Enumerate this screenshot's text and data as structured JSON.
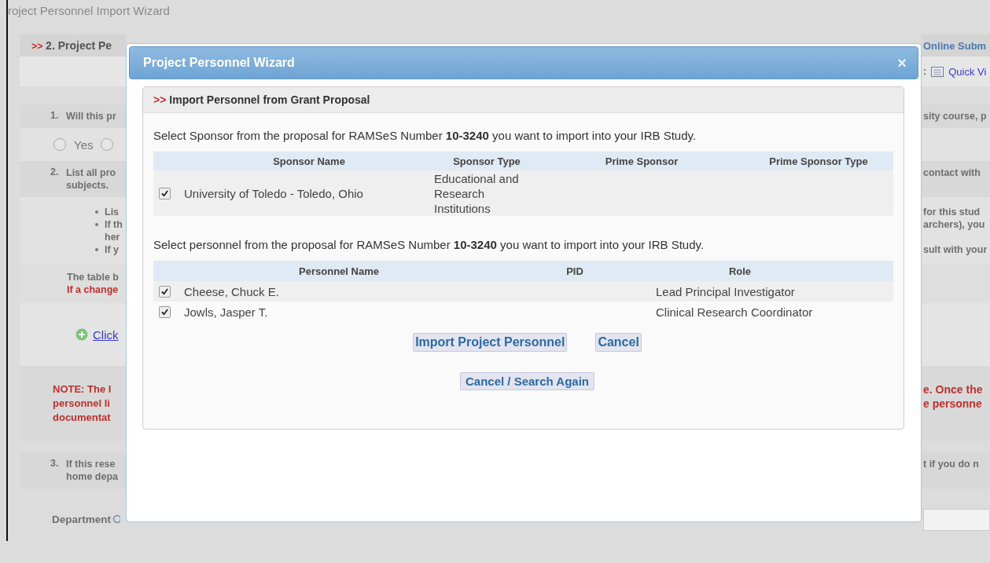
{
  "background": {
    "title": "roject Personnel Import Wizard",
    "rows": [
      {
        "kind": "header",
        "marker": ">>",
        "left": "2. Project Pe",
        "right": "Online Subm"
      },
      {
        "kind": "toolbar",
        "right_separator": ":",
        "right_link": "Quick Vi"
      },
      {
        "kind": "question",
        "number": "1.",
        "lines": [
          "Will this pr"
        ],
        "right_lines": [
          "sity course, p"
        ]
      },
      {
        "kind": "radios",
        "options": [
          {
            "label": "Yes",
            "selected": false
          },
          {
            "selected": false
          }
        ]
      },
      {
        "kind": "question",
        "number": "2.",
        "lines": [
          "List all pro",
          "subjects."
        ],
        "right_lines": [
          "contact with"
        ]
      },
      {
        "kind": "bullets",
        "lines": [
          {
            "text": "Lis",
            "bullet": true,
            "right": "for this stud"
          },
          {
            "text": "If th",
            "bullet": true,
            "right": "archers), you"
          },
          {
            "text": "her",
            "bullet": false
          },
          {
            "text": "If y",
            "bullet": true,
            "right": "sult with your"
          }
        ]
      },
      {
        "kind": "table-note",
        "lines": [
          {
            "text": "The table b",
            "alert": false
          },
          {
            "text": "If a change",
            "alert": true
          }
        ]
      },
      {
        "kind": "link",
        "link": "Click"
      },
      {
        "kind": "note",
        "lines": [
          "NOTE: The I",
          "personnel li",
          "documentat"
        ],
        "right_lines": [
          "e. Once the",
          "e personne"
        ]
      },
      {
        "kind": "question",
        "number": "3.",
        "lines": [
          "If this rese",
          "home depa"
        ],
        "right_lines": [
          "t if you do n"
        ]
      },
      {
        "kind": "field",
        "label": "Department"
      }
    ]
  },
  "dialog": {
    "title": "Project Personnel Wizard",
    "close": "×",
    "panel": {
      "marker": ">>",
      "title": "Import Personnel from Grant Proposal",
      "sponsor_prompt": "Select Sponsor from the proposal for RAMSeS Number **10-3240** you want to import into your IRB Study.",
      "sponsor_columns": [
        "Sponsor Name",
        "Sponsor Type",
        "Prime Sponsor",
        "Prime Sponsor Type"
      ],
      "sponsors": [
        {
          "checked": true,
          "name": "University of Toledo - Toledo, Ohio",
          "type": "Educational and Research Institutions"
        }
      ],
      "personnel_prompt": "Select personnel from the proposal for RAMSeS Number **10-3240** you want to import into your IRB Study.",
      "personnel_columns": [
        "Personnel Name",
        "PID",
        "Role"
      ],
      "personnel": [
        {
          "checked": true,
          "name": "Cheese, Chuck E.",
          "role": "Lead Principal Investigator"
        },
        {
          "checked": true,
          "name": "Jowls, Jasper T.",
          "role": "Clinical Research Coordinator"
        }
      ],
      "buttons": [
        "Import Project Personnel",
        "Cancel"
      ],
      "secondary_button": "Cancel / Search Again"
    }
  }
}
